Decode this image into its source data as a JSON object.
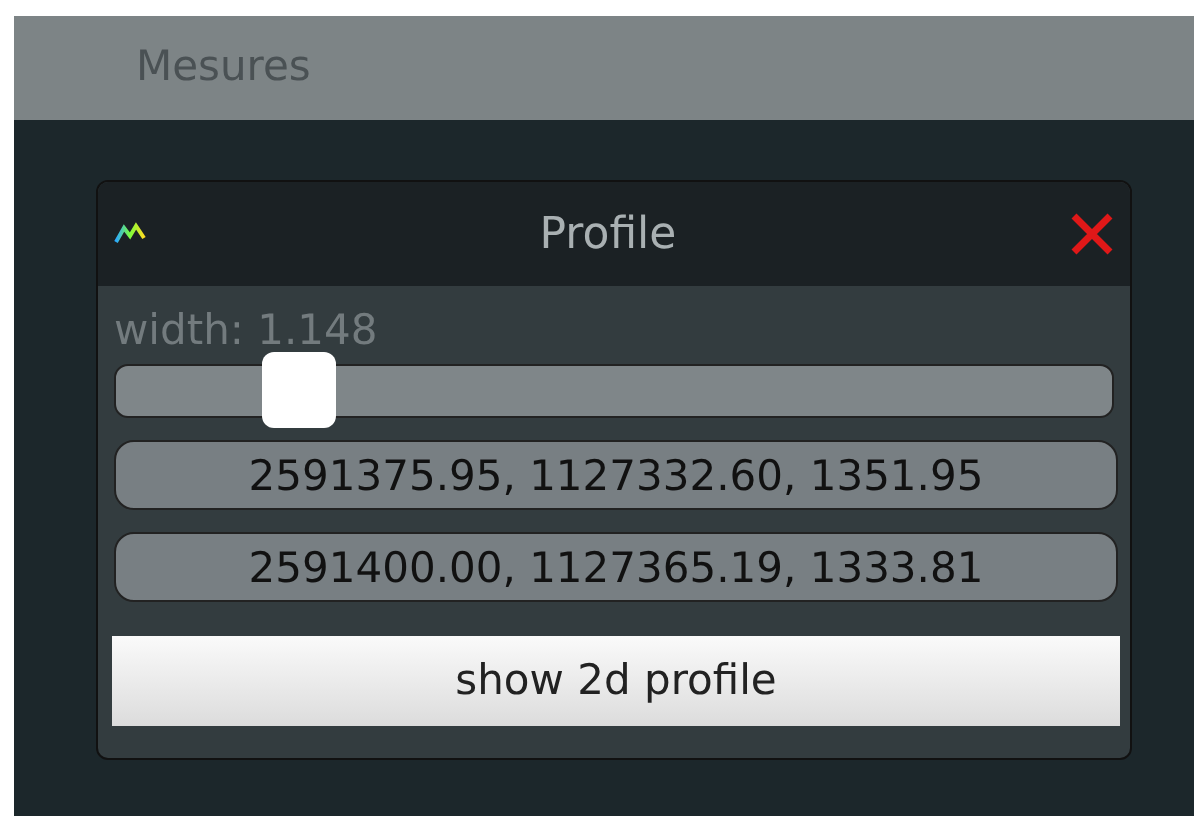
{
  "header": {
    "title": "Mesures"
  },
  "dialog": {
    "title": "Profile",
    "width_label": "width: 1.148",
    "slider": {
      "level": 0.16
    },
    "points": [
      "2591375.95, 1127332.60, 1351.95",
      "2591400.00, 1127365.19, 1333.81"
    ],
    "button": "show 2d profile"
  }
}
